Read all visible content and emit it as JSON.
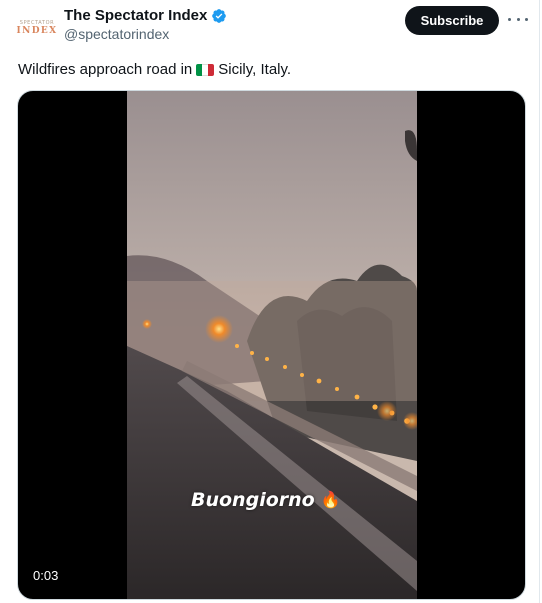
{
  "account": {
    "avatar_top": "SPECTATOR",
    "avatar_bottom": "INDEX",
    "name": "The Spectator Index",
    "handle": "@spectatorindex",
    "verified_icon": "verified-badge-icon",
    "subscribe_label": "Subscribe",
    "more_icon": "more-options-icon"
  },
  "tweet": {
    "text_before_flag": "Wildfires approach road in",
    "flag_icon": "italy-flag-icon",
    "text_after_flag": "Sicily, Italy."
  },
  "video": {
    "overlay_caption": "Buongiorno",
    "caption_emoji": "🔥",
    "duration": "0:03"
  },
  "colors": {
    "text_primary": "#0f1419",
    "text_secondary": "#536471",
    "verified_blue": "#1d9bf0",
    "subscribe_bg": "#0f1419",
    "flag_green": "#009246",
    "flag_white": "#ffffff",
    "flag_red": "#ce2b37"
  }
}
